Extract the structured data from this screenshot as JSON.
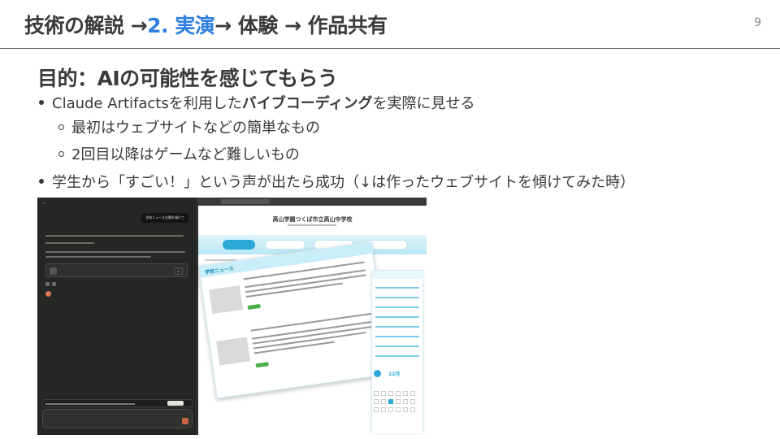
{
  "slide": {
    "page_number": "9",
    "header": {
      "part1": "技術の解説 →",
      "highlight": "2. 実演",
      "part2": "→ 体験 → 作品共有"
    },
    "heading": "目的：AIの可能性を感じてもらう",
    "bullets": [
      {
        "pre": "Claude Artifactsを利用した",
        "bold": "バイブコーディング",
        "post": "を実際に見せる"
      },
      {
        "text": "最初はウェブサイトなどの簡単なもの"
      },
      {
        "text": "2回目以降はゲームなど難しいもの"
      },
      {
        "text": "学生から「すごい！」という声が出たら成功（↓は作ったウェブサイトを傾けてみた時）"
      }
    ]
  },
  "screenshot": {
    "chat": {
      "user_message": "学校ニュースの欄を傾けて"
    },
    "website": {
      "school_name": "高山学園つくば市立高山中学校",
      "news_heading": "学校ニュース",
      "calendar_month": "12月"
    }
  },
  "colors": {
    "accent": "#2f7fe0",
    "site_primary": "#2aa8d6",
    "claude_orange": "#d97757"
  }
}
